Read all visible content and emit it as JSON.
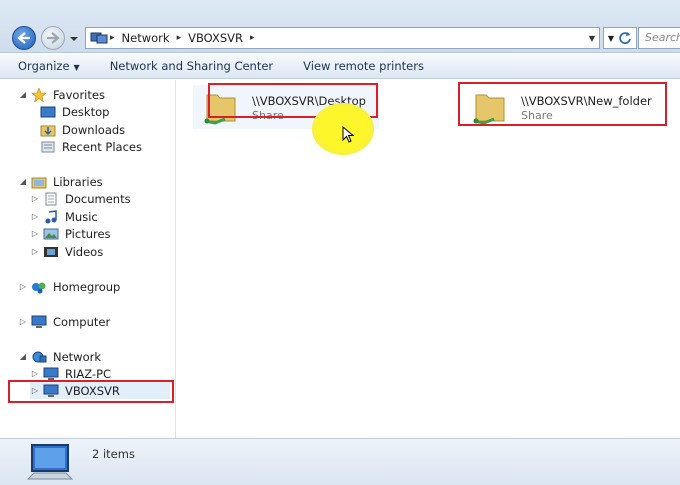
{
  "address_bar": {
    "crumbs": [
      "Network",
      "VBOXSVR"
    ],
    "search_placeholder": "Search"
  },
  "toolbar": {
    "organize": "Organize",
    "network_sharing": "Network and Sharing Center",
    "view_printers": "View remote printers"
  },
  "nav": {
    "favorites": "Favorites",
    "desktop": "Desktop",
    "downloads": "Downloads",
    "recent_places": "Recent Places",
    "libraries": "Libraries",
    "documents": "Documents",
    "music": "Music",
    "pictures": "Pictures",
    "videos": "Videos",
    "homegroup": "Homegroup",
    "computer": "Computer",
    "network": "Network",
    "riaz_pc": "RIAZ-PC",
    "vboxsvr": "VBOXSVR"
  },
  "items": [
    {
      "name": "\\\\VBOXSVR\\Desktop",
      "type": "Share"
    },
    {
      "name": "\\\\VBOXSVR\\New_folder",
      "type": "Share"
    }
  ],
  "status": {
    "count": "2 items"
  },
  "colors": {
    "highlight_box": "#d9202a",
    "cursor_glow": "#fdf62a"
  }
}
